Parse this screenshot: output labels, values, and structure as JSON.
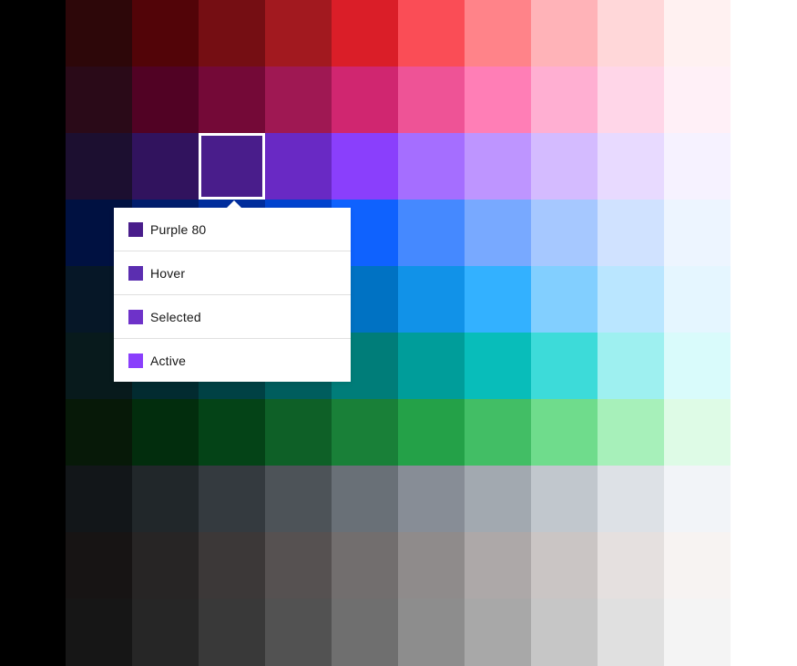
{
  "palette": {
    "rows": [
      [
        "#2d0709",
        "#520408",
        "#750e13",
        "#a2191f",
        "#da1e28",
        "#fa4d56",
        "#ff8389",
        "#ffb3b8",
        "#ffd7d9",
        "#fff1f1"
      ],
      [
        "#2a0a18",
        "#510224",
        "#740937",
        "#9f1853",
        "#d02670",
        "#ee5396",
        "#ff7eb6",
        "#ffafd2",
        "#ffd6e8",
        "#fff0f7"
      ],
      [
        "#1c0f30",
        "#31135e",
        "#491d8b",
        "#6929c4",
        "#8a3ffc",
        "#a56eff",
        "#be95ff",
        "#d4bbff",
        "#e8daff",
        "#f6f2ff"
      ],
      [
        "#001141",
        "#001d6c",
        "#002d9c",
        "#0043ce",
        "#0f62fe",
        "#4589ff",
        "#78a9ff",
        "#a6c8ff",
        "#d0e2ff",
        "#edf5ff"
      ],
      [
        "#061727",
        "#012749",
        "#003a6d",
        "#00539a",
        "#0072c3",
        "#1192e8",
        "#33b1ff",
        "#82cfff",
        "#bae6ff",
        "#e5f6ff"
      ],
      [
        "#081a1c",
        "#022b30",
        "#004144",
        "#005d5d",
        "#007d79",
        "#009d9a",
        "#08bdba",
        "#3ddbd9",
        "#9ef0f0",
        "#d9fbfb"
      ],
      [
        "#071908",
        "#022d0d",
        "#044317",
        "#0e6027",
        "#198038",
        "#24a148",
        "#42be65",
        "#6fdc8c",
        "#a7f0ba",
        "#defbe6"
      ],
      [
        "#121619",
        "#21272a",
        "#343a3f",
        "#4d5358",
        "#697077",
        "#878d96",
        "#a2a9b0",
        "#c1c7cd",
        "#dde1e6",
        "#f2f4f8"
      ],
      [
        "#171414",
        "#272525",
        "#3c3838",
        "#565151",
        "#726e6e",
        "#8f8b8b",
        "#ada8a8",
        "#cac5c4",
        "#e5e0df",
        "#f7f3f2"
      ],
      [
        "#161616",
        "#262626",
        "#393939",
        "#525252",
        "#6f6f6f",
        "#8d8d8d",
        "#a8a8a8",
        "#c6c6c6",
        "#e0e0e0",
        "#f4f4f4"
      ]
    ],
    "selected": {
      "row": 2,
      "col": 2
    }
  },
  "tooltip": {
    "items": [
      {
        "label": "Purple 80",
        "color": "#491d8b"
      },
      {
        "label": "Hover",
        "color": "#5b2eb0"
      },
      {
        "label": "Selected",
        "color": "#6e32c9"
      },
      {
        "label": "Active",
        "color": "#8a3ffc"
      }
    ]
  }
}
